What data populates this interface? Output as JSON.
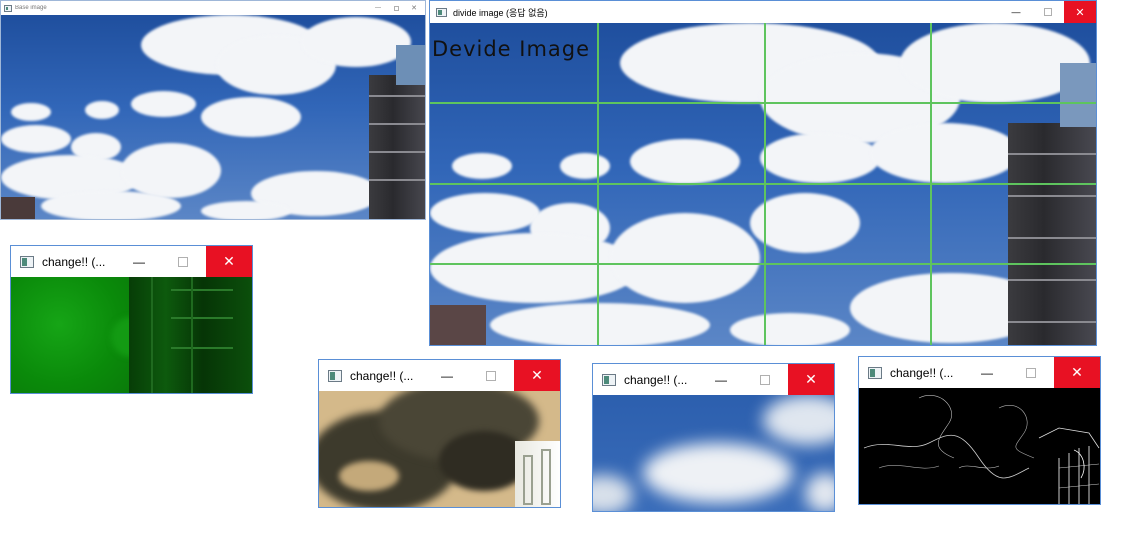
{
  "windows": {
    "base": {
      "title": "Base image"
    },
    "divide": {
      "title": "divide image (응답 없음)",
      "overlay_text": "Devide Image"
    },
    "change1": {
      "title": "change!! (..."
    },
    "change2": {
      "title": "change!! (..."
    },
    "change3": {
      "title": "change!! (..."
    },
    "change4": {
      "title": "change!! (..."
    }
  },
  "controls": {
    "minimize": "—",
    "close": "✕"
  },
  "colors": {
    "close_button": "#e81123",
    "grid_lines": "#5ec45e",
    "green_filter": "#0a8c0a",
    "sepia_filter": "#d9bf8a",
    "edge_background": "#000000"
  },
  "icons": [
    "app-icon",
    "minimize-icon",
    "maximize-icon",
    "close-icon"
  ]
}
